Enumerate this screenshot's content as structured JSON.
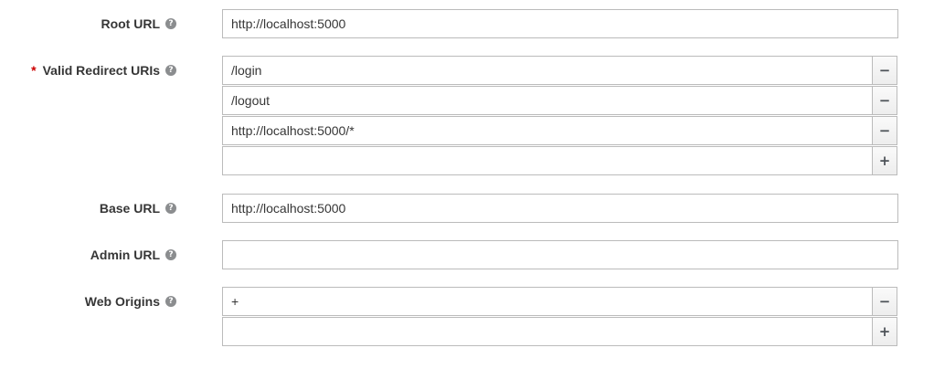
{
  "fields": {
    "root_url": {
      "label": "Root URL",
      "value": "http://localhost:5000"
    },
    "redirect_uris": {
      "required_marker": "*",
      "label": "Valid Redirect URIs",
      "values": [
        "/login",
        "/logout",
        "http://localhost:5000/*",
        ""
      ]
    },
    "base_url": {
      "label": "Base URL",
      "value": "http://localhost:5000"
    },
    "admin_url": {
      "label": "Admin URL",
      "value": ""
    },
    "web_origins": {
      "label": "Web Origins",
      "values": [
        "+",
        ""
      ]
    }
  },
  "icons": {
    "help": "help-circle-icon",
    "remove": "minus-icon",
    "add": "plus-icon"
  },
  "glyphs": {
    "help": "?",
    "remove": "−",
    "add": "+"
  }
}
